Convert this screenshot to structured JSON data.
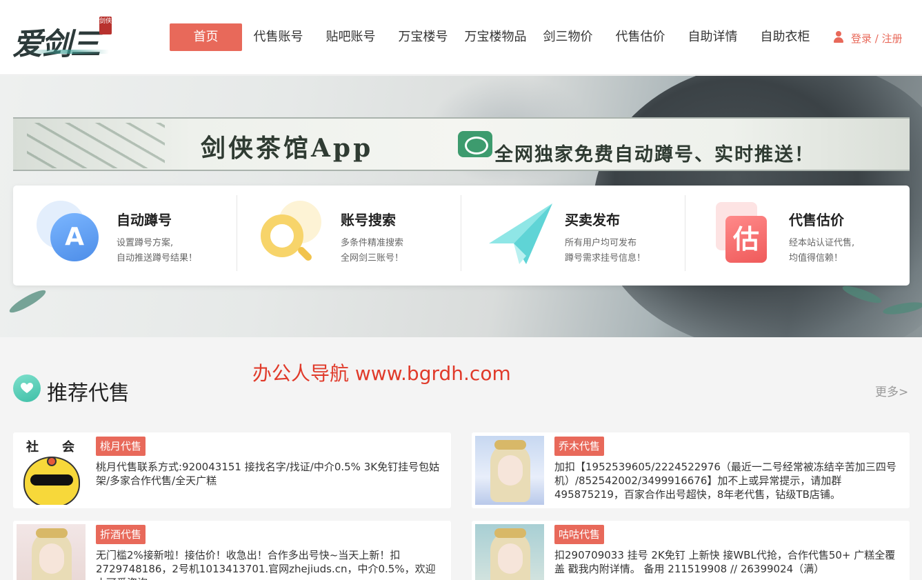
{
  "header": {
    "logo_text": "爱剑三",
    "logo_seal": "剑侠",
    "nav": [
      {
        "label": "首页",
        "active": true
      },
      {
        "label": "代售账号"
      },
      {
        "label": "贴吧账号"
      },
      {
        "label": "万宝楼号"
      },
      {
        "label": "万宝楼物品"
      },
      {
        "label": "剑三物价"
      },
      {
        "label": "代售估价"
      },
      {
        "label": "自助详情"
      },
      {
        "label": "自助衣柜"
      }
    ],
    "auth": {
      "login": "登录",
      "separator": "/",
      "register": "注册"
    }
  },
  "banner": {
    "title": "剑侠茶馆App",
    "subtitle": "全网独家免费自动蹲号、实时推送！"
  },
  "features": [
    {
      "icon": "a-icon",
      "title": "自动蹲号",
      "line1": "设置蹲号方案,",
      "line2": "自动推送蹲号结果！"
    },
    {
      "icon": "search-icon",
      "title": "账号搜索",
      "line1": "多条件精准搜索",
      "line2": "全网剑三账号！"
    },
    {
      "icon": "paper-plane-icon",
      "title": "买卖发布",
      "line1": "所有用户均可发布",
      "line2": "蹲号需求挂号信息！"
    },
    {
      "icon": "estimate-icon",
      "title": "代售估价",
      "line1": "经本站认证代售,",
      "line2": "均值得信赖！"
    }
  ],
  "watermark": "办公人导航 www.bgrdh.com",
  "section": {
    "title": "推荐代售",
    "more": "更多>"
  },
  "cards": [
    {
      "tag": "桃月代售",
      "thumb_text_left": "社",
      "thumb_text_right": "会",
      "desc": "桃月代售联系方式:920043151 接找名字/找证/中介0.5% 3K免钉挂号包姑架/多家合作代售/全天广糕"
    },
    {
      "tag": "乔木代售",
      "desc": "加扣【1952539605/2224522976（最近一二号经常被冻结辛苦加三四号机）/852542002/3499916676】加不上或异常提示，请加群495875219，百家合作出号超快，8年老代售，钻级TB店铺。"
    },
    {
      "tag": "折酒代售",
      "desc": "无门槛2%接新啦！接估价！收急出！合作多出号快~当天上新！扣2729748186，2号机1013413701.官网zhejiuds.cn，中介0.5%，欢迎小可爱咨询～"
    },
    {
      "tag": "咕咕代售",
      "desc": "扣290709033 挂号 2K免钉 上新快 接WBL代抢，合作代售50+ 广糕全覆盖 戳我内附详情。 备用 211519908 // 26399024（满）"
    }
  ],
  "colors": {
    "accent": "#e8695a",
    "watermark": "#e03a2a",
    "section_icon": "#3fbfa7"
  }
}
